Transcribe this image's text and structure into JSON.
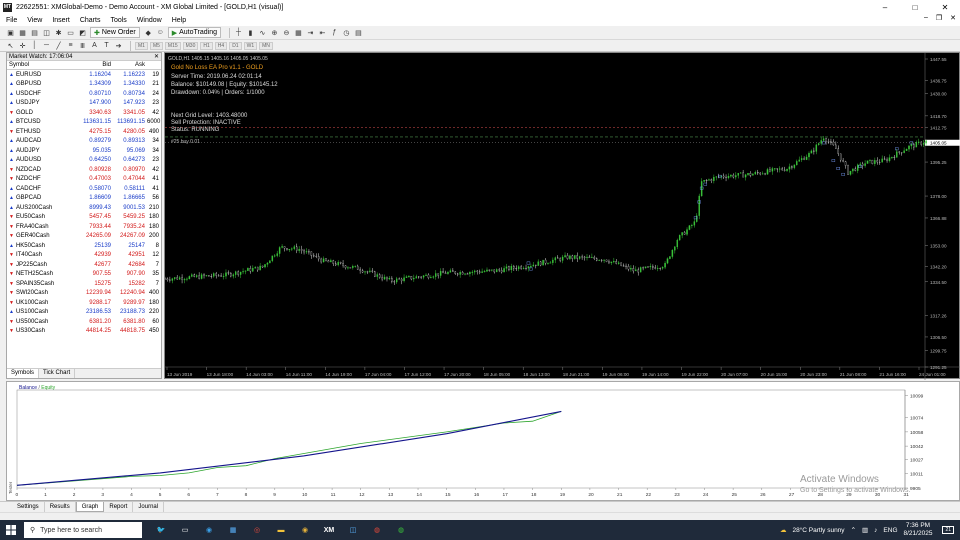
{
  "window": {
    "title": "22622551: XMGlobal-Demo - Demo Account - XM Global Limited - [GOLD,H1 (visual)]",
    "controls": [
      "–",
      "□",
      "✕"
    ]
  },
  "menu": [
    "File",
    "View",
    "Insert",
    "Charts",
    "Tools",
    "Window",
    "Help"
  ],
  "mdi_controls": [
    "–",
    "❐",
    "✕"
  ],
  "toolbar": {
    "new_order": "New Order",
    "autotrading": "AutoTrading",
    "timeframes": [
      "M1",
      "M5",
      "M15",
      "M30",
      "H1",
      "H4",
      "D1",
      "W1",
      "MN"
    ]
  },
  "market_watch": {
    "title": "Market Watch: 17:06:04",
    "close": "✕",
    "columns": [
      "Symbol",
      "Bid",
      "Ask",
      ""
    ],
    "rows": [
      {
        "symbol": "EURUSD",
        "bid": "1.16204",
        "ask": "1.16223",
        "spread": "19",
        "dir": "up"
      },
      {
        "symbol": "GBPUSD",
        "bid": "1.34309",
        "ask": "1.34330",
        "spread": "21",
        "dir": "up"
      },
      {
        "symbol": "USDCHF",
        "bid": "0.80710",
        "ask": "0.80734",
        "spread": "24",
        "dir": "up"
      },
      {
        "symbol": "USDJPY",
        "bid": "147.900",
        "ask": "147.923",
        "spread": "23",
        "dir": "up"
      },
      {
        "symbol": "GOLD",
        "bid": "3340.63",
        "ask": "3341.05",
        "spread": "42",
        "dir": "dn"
      },
      {
        "symbol": "BTCUSD",
        "bid": "113631.15",
        "ask": "113691.15",
        "spread": "6000",
        "dir": "up"
      },
      {
        "symbol": "ETHUSD",
        "bid": "4275.15",
        "ask": "4280.05",
        "spread": "490",
        "dir": "dn"
      },
      {
        "symbol": "AUDCAD",
        "bid": "0.89279",
        "ask": "0.89313",
        "spread": "34",
        "dir": "up"
      },
      {
        "symbol": "AUDJPY",
        "bid": "95.035",
        "ask": "95.069",
        "spread": "34",
        "dir": "up"
      },
      {
        "symbol": "AUDUSD",
        "bid": "0.64250",
        "ask": "0.64273",
        "spread": "23",
        "dir": "up"
      },
      {
        "symbol": "NZDCAD",
        "bid": "0.80928",
        "ask": "0.80970",
        "spread": "42",
        "dir": "dn"
      },
      {
        "symbol": "NZDCHF",
        "bid": "0.47003",
        "ask": "0.47044",
        "spread": "41",
        "dir": "dn"
      },
      {
        "symbol": "CADCHF",
        "bid": "0.58070",
        "ask": "0.58111",
        "spread": "41",
        "dir": "up"
      },
      {
        "symbol": "GBPCAD",
        "bid": "1.86609",
        "ask": "1.86665",
        "spread": "56",
        "dir": "up"
      },
      {
        "symbol": "AUS200Cash",
        "bid": "8999.43",
        "ask": "9001.53",
        "spread": "210",
        "dir": "up"
      },
      {
        "symbol": "EU50Cash",
        "bid": "5457.45",
        "ask": "5459.25",
        "spread": "180",
        "dir": "dn"
      },
      {
        "symbol": "FRA40Cash",
        "bid": "7933.44",
        "ask": "7935.24",
        "spread": "180",
        "dir": "dn"
      },
      {
        "symbol": "GER40Cash",
        "bid": "24265.09",
        "ask": "24267.09",
        "spread": "200",
        "dir": "dn"
      },
      {
        "symbol": "HK50Cash",
        "bid": "25139",
        "ask": "25147",
        "spread": "8",
        "dir": "up"
      },
      {
        "symbol": "IT40Cash",
        "bid": "42939",
        "ask": "42951",
        "spread": "12",
        "dir": "dn"
      },
      {
        "symbol": "JP225Cash",
        "bid": "42677",
        "ask": "42684",
        "spread": "7",
        "dir": "dn"
      },
      {
        "symbol": "NETH25Cash",
        "bid": "907.55",
        "ask": "907.90",
        "spread": "35",
        "dir": "dn"
      },
      {
        "symbol": "SPAIN35Cash",
        "bid": "15275",
        "ask": "15282",
        "spread": "7",
        "dir": "dn"
      },
      {
        "symbol": "SWI20Cash",
        "bid": "12239.94",
        "ask": "12240.94",
        "spread": "400",
        "dir": "dn"
      },
      {
        "symbol": "UK100Cash",
        "bid": "9288.17",
        "ask": "9289.97",
        "spread": "180",
        "dir": "dn"
      },
      {
        "symbol": "US100Cash",
        "bid": "23186.53",
        "ask": "23188.73",
        "spread": "220",
        "dir": "up"
      },
      {
        "symbol": "US500Cash",
        "bid": "6381.20",
        "ask": "6381.80",
        "spread": "60",
        "dir": "dn"
      },
      {
        "symbol": "US30Cash",
        "bid": "44814.25",
        "ask": "44818.75",
        "spread": "450",
        "dir": "dn"
      }
    ],
    "tabs": [
      "Symbols",
      "Tick Chart"
    ]
  },
  "chart": {
    "header": "GOLD,H1  1405.15 1405.16 1405.05 1405.05",
    "ea_name": "Gold No Loss EA Pro v1.1 - GOLD",
    "server_time": "Server Time: 2019.06.24 02:01:14",
    "balance": "Balance: $10149.08 | Equity: $10145.12",
    "drawdown": "Drawdown: 0.04% | Orders: 1/1000",
    "next_grid": "Next Grid Level: 1403.48000",
    "sell_protection": "Sell Protection: INACTIVE",
    "status": "Status: RUNNING",
    "order_label": "#25 buy 0.01",
    "price_labels": [
      "1447.55",
      "1436.75",
      "1430.00",
      "1418.70",
      "1412.75",
      "1406.06",
      "1395.25",
      "1378.00",
      "1366.88",
      "1353.00",
      "1342.20",
      "1334.50",
      "1317.26",
      "1306.50",
      "1299.75",
      "1291.25"
    ],
    "price_range": [
      1291.25,
      1447.55
    ],
    "time_labels": [
      "13 Jun 2019",
      "13 Jun 18:00",
      "14 Jun 03:00",
      "14 Jun 11:00",
      "14 Jun 19:00",
      "17 Jun 04:00",
      "17 Jun 12:00",
      "17 Jun 20:00",
      "18 Jun 05:00",
      "18 Jun 13:00",
      "18 Jun 21:00",
      "19 Jun 06:00",
      "19 Jun 14:00",
      "19 Jun 22:00",
      "20 Jun 07:00",
      "20 Jun 15:00",
      "20 Jun 23:00",
      "21 Jun 08:00",
      "21 Jun 16:00",
      "24 Jun 01:00"
    ],
    "current_price": "1405.05",
    "colors": {
      "bull": "#3ac43a",
      "bear": "#dddddd",
      "grid": "#1e1e1e",
      "level": "#4d8f4d",
      "protect": "#b04040"
    }
  },
  "graph": {
    "legend_balance": "Balance",
    "legend_sep": " / ",
    "legend_equity": "Equity",
    "y_labels": [
      "10099",
      "10074",
      "10058",
      "10042",
      "10027",
      "10011",
      "9905"
    ],
    "x_labels": [
      "0",
      "1",
      "2",
      "3",
      "4",
      "5",
      "6",
      "7",
      "8",
      "9",
      "10",
      "11",
      "12",
      "13",
      "14",
      "15",
      "16",
      "17",
      "18",
      "19",
      "20",
      "21",
      "22",
      "23",
      "24",
      "25",
      "26",
      "27",
      "28",
      "29",
      "30",
      "31"
    ],
    "x_range": [
      0,
      31
    ],
    "y_range": [
      9995,
      10105
    ],
    "balance_points": [
      [
        0,
        9998
      ],
      [
        5,
        10012
      ],
      [
        10,
        10031
      ],
      [
        15,
        10056
      ],
      [
        19,
        10081
      ]
    ],
    "equity_points": [
      [
        0,
        9998
      ],
      [
        4,
        10008
      ],
      [
        5,
        10009
      ],
      [
        6,
        10012
      ],
      [
        7,
        10018
      ],
      [
        8,
        10020
      ],
      [
        9,
        10028
      ],
      [
        12,
        10045
      ],
      [
        15,
        10058
      ],
      [
        17,
        10068
      ],
      [
        18,
        10070
      ],
      [
        19,
        10081
      ]
    ],
    "colors": {
      "balance": "#14148c",
      "equity": "#2ca52c"
    },
    "side_label": "Tester"
  },
  "tester_tabs": [
    "Settings",
    "Results",
    "Graph",
    "Report",
    "Journal"
  ],
  "active_tab": "Graph",
  "watermark": {
    "line1": "Activate Windows",
    "line2": "Go to Settings to activate Windows."
  },
  "taskbar": {
    "search": "Type here to search",
    "weather": "28°C  Partly sunny",
    "lang": "ENG",
    "time": "7:36 PM",
    "date": "8/21/2025",
    "notif": "21"
  }
}
